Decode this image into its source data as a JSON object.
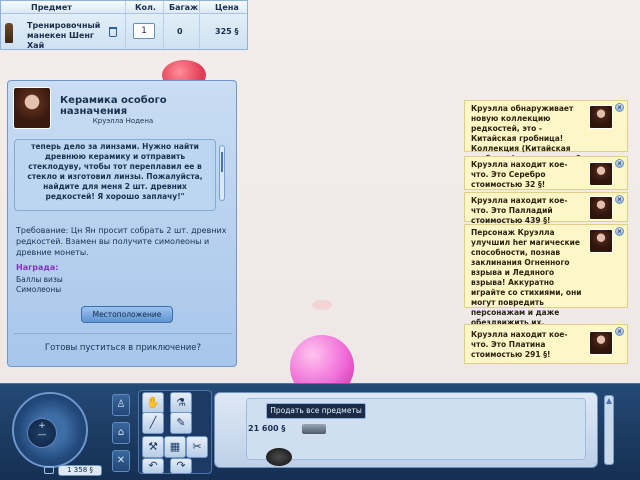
{
  "buy_table": {
    "headers": {
      "item": "Предмет",
      "qty": "Кол.",
      "bag": "Багаж",
      "price": "Цена"
    },
    "row": {
      "name": "Тренировочный манекен Шенг Хай",
      "qty": "1",
      "bag": "0",
      "price": "325 §"
    }
  },
  "quest": {
    "title": "Керамика особого назначения",
    "giver": "Круэлла Нодена",
    "text": "теперь дело за линзами. Нужно найти древнюю керамику и отправить стеклодуву, чтобы тот переплавил ее в стекло и изготовил линзы. Пожалуйста, найдите для меня 2 шт. древних редкостей! Я хорошо заплачу!\"",
    "requirement": "Требование: Цн Ян просит собрать 2 шт. древних редкостей. Взамен вы получите симолеоны и древние монеты.",
    "reward_header": "Награда:",
    "rewards": [
      "Баллы визы",
      "Симолеоны"
    ],
    "location_button": "Местоположение",
    "ready": "Готовы пуститься в приключение?"
  },
  "notifications": [
    {
      "text": "Круэлла обнаруживает новую коллекцию редкостей, это - Китайская гробница! Коллекция (Китайская гробница) насчитывает 9 шт."
    },
    {
      "text": "Круэлла находит кое-что. Это Серебро стоимостью 32 §!"
    },
    {
      "text": "Круэлла находит кое-что. Это Палладий стоимостью 439 §!"
    },
    {
      "text": "Персонаж Круэлла улучшил her магические способности, познав заклинания Огненного взрыва и Ледяного взрыва! Аккуратно играйте со стихиями, они могут повредить персонажам и даже обездвижить их."
    },
    {
      "text": "Круэлла находит кое-что. Это Платина стоимостью 291 §!"
    }
  ],
  "bottom": {
    "money": "1 358 §",
    "funds": "21 600 §",
    "sell_tooltip": "Продать все предметы"
  }
}
